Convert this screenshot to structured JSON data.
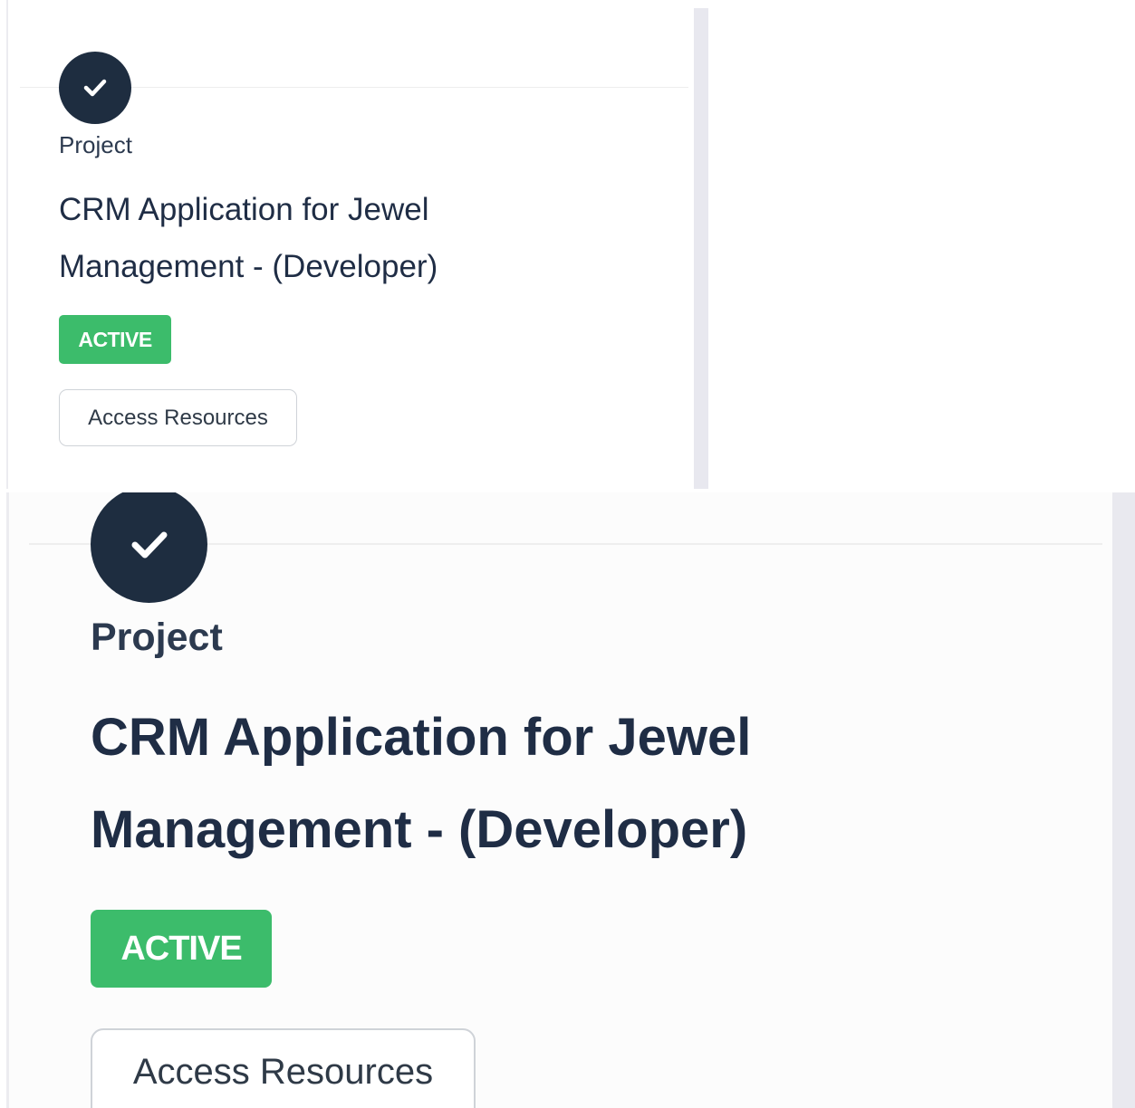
{
  "project_card": {
    "category": "Project",
    "title_line1": "CRM Application for Jewel",
    "title_line2": "Management - (Developer)",
    "status": "ACTIVE",
    "action_label": "Access Resources",
    "status_icon": "check-icon",
    "colors": {
      "icon_bg": "#1e2d40",
      "title": "#1f2d45",
      "badge_bg": "#3cbc6b",
      "badge_text": "#ffffff",
      "button_border": "#cfd3d8"
    }
  }
}
